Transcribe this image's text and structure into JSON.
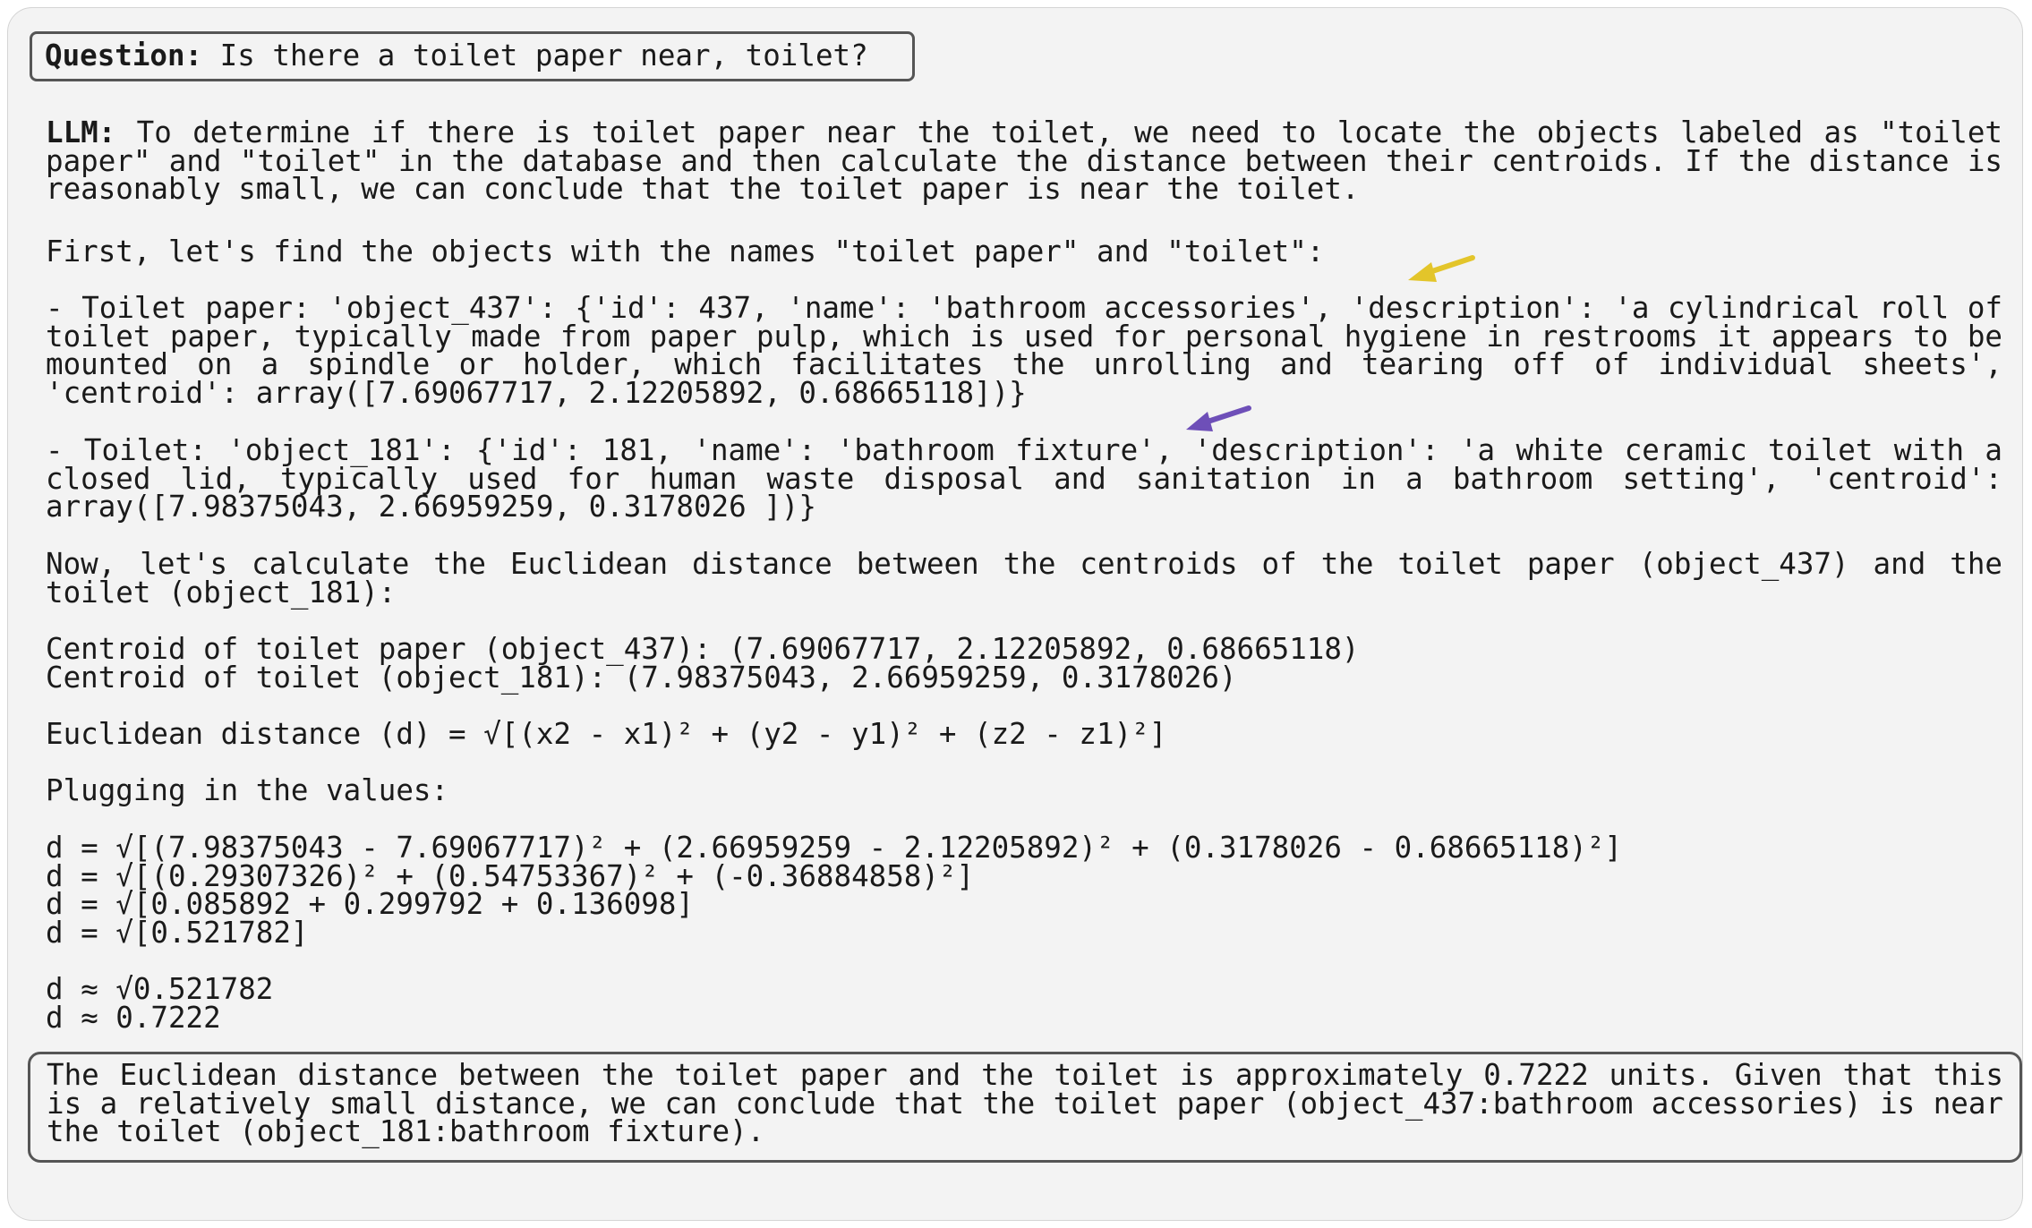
{
  "question": {
    "label": "Question:",
    "text": " Is there a toilet paper near, toilet?"
  },
  "llm": {
    "label": "LLM:",
    "intro": " To determine if there is toilet paper near the toilet, we need to locate the objects labeled as \"toilet paper\" and \"toilet\" in the database and then calculate the distance between their centroids. If the distance is reasonably small, we can conclude that the toilet paper is near the toilet.",
    "first_line": "First, let's find the objects with the names \"toilet paper\" and \"toilet\":",
    "toilet_paper_entry": "- Toilet paper: 'object_437': {'id': 437, 'name': 'bathroom accessories', 'description': 'a cylindrical roll of toilet paper, typically made from paper pulp, which is used for personal hygiene in restrooms it appears to be mounted on a spindle or holder, which facilitates the unrolling and tearing off of individual sheets', 'centroid': array([7.69067717, 2.12205892, 0.68665118])}",
    "toilet_entry": "- Toilet: 'object_181': {'id': 181, 'name': 'bathroom fixture', 'description': 'a white ceramic toilet with a closed lid, typically used for human waste disposal and sanitation in a bathroom setting', 'centroid': array([7.98375043, 2.66959259, 0.3178026 ])}",
    "now_line": "Now, let's calculate the Euclidean distance between the centroids of the toilet paper (object_437) and the toilet (object_181):",
    "centroid_lines": [
      "Centroid of toilet paper (object_437): (7.69067717, 2.12205892, 0.68665118)",
      "Centroid of toilet (object_181): (7.98375043, 2.66959259, 0.3178026)"
    ],
    "formula": "Euclidean distance (d) = √[(x2 - x1)² + (y2 - y1)² + (z2 - z1)²]",
    "plugging": "Plugging in the values:",
    "calc_lines": [
      "d = √[(7.98375043 - 7.69067717)² + (2.66959259 - 2.12205892)² + (0.3178026 - 0.68665118)²]",
      "d = √[(0.29307326)² + (0.54753367)² + (-0.36884858)²]",
      "d = √[0.085892 + 0.299792 + 0.136098]",
      "d = √[0.521782]"
    ],
    "approx_lines": [
      "d ≈ √0.521782",
      "d ≈ 0.7222"
    ],
    "conclusion": "The Euclidean distance between the toilet paper and the toilet is approximately 0.7222 units. Given that this is a relatively small distance, we can conclude that the toilet paper (object_437:bathroom accessories) is near the toilet (object_181:bathroom fixture)."
  },
  "colors": {
    "yellow_arrow": "#e3c52a",
    "purple_arrow": "#6e4fb8",
    "box_border": "#555555",
    "panel_background": "#f3f3f3"
  }
}
